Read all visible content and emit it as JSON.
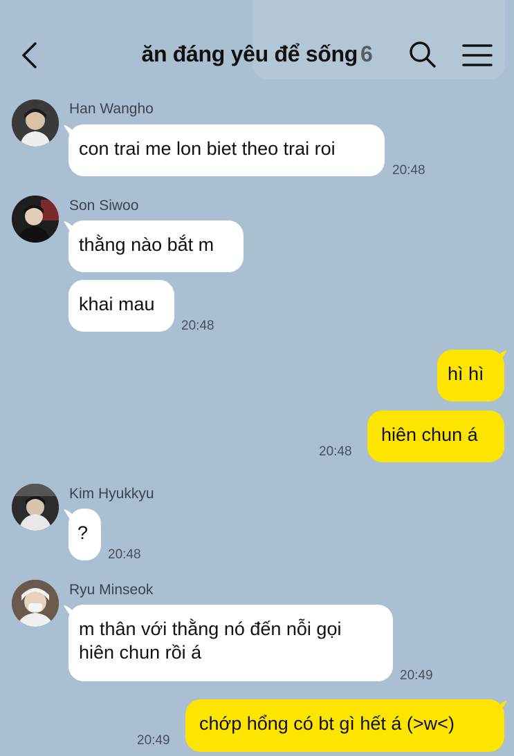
{
  "header": {
    "title": "ăn đáng yêu để sống",
    "member_count": "6"
  },
  "messages": [
    {
      "sender": "Han Wangho",
      "texts": [
        "con trai me lon biet theo trai roi"
      ],
      "time": "20:48"
    },
    {
      "sender": "Son Siwoo",
      "texts": [
        "thằng nào bắt m",
        "khai mau"
      ],
      "time": "20:48"
    },
    {
      "sender": "me",
      "texts": [
        "hì hì",
        "hiên chun á"
      ],
      "time": "20:48"
    },
    {
      "sender": "Kim Hyukkyu",
      "texts": [
        "?"
      ],
      "time": "20:48"
    },
    {
      "sender": "Ryu Minseok",
      "texts": [
        "m thân với thằng nó đến nỗi gọi",
        "hiên chun rồi á"
      ],
      "time": "20:49"
    },
    {
      "sender": "me",
      "texts": [
        "chớp hổng có bt gì hết á (>w<)"
      ],
      "time": "20:49"
    }
  ],
  "colors": {
    "background": "#aabfd1",
    "incoming_bubble": "#ffffff",
    "outgoing_bubble": "#fee500"
  },
  "icons": [
    "back-arrow-icon",
    "search-icon",
    "menu-icon"
  ]
}
